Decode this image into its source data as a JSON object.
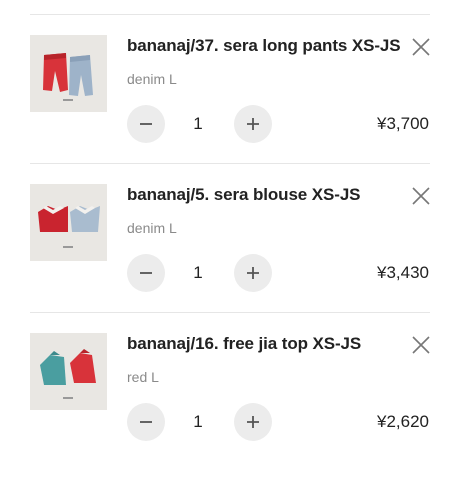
{
  "cart": {
    "items": [
      {
        "title": "bananaj/37. sera long pants XS-JS",
        "variant": "denim L",
        "quantity": "1",
        "price": "¥3,700",
        "thumbnail_icon": "pants-thumbnail",
        "thumbnail_colors": [
          "#d8333a",
          "#9eb3c9"
        ]
      },
      {
        "title": "bananaj/5. sera blouse XS-JS",
        "variant": "denim L",
        "quantity": "1",
        "price": "¥3,430",
        "thumbnail_icon": "blouse-thumbnail",
        "thumbnail_colors": [
          "#c9242f",
          "#a9bccf"
        ]
      },
      {
        "title": "bananaj/16. free jia top XS-JS",
        "variant": "red L",
        "quantity": "1",
        "price": "¥2,620",
        "thumbnail_icon": "top-thumbnail",
        "thumbnail_colors": [
          "#4a9ea0",
          "#d8333a"
        ]
      }
    ]
  },
  "icons": {
    "remove": "close-icon",
    "decrease": "minus-icon",
    "increase": "plus-icon"
  },
  "colors": {
    "stepper_bg": "#ececec",
    "divider": "#e6e6e6",
    "variant_text": "#8a8a8a"
  }
}
